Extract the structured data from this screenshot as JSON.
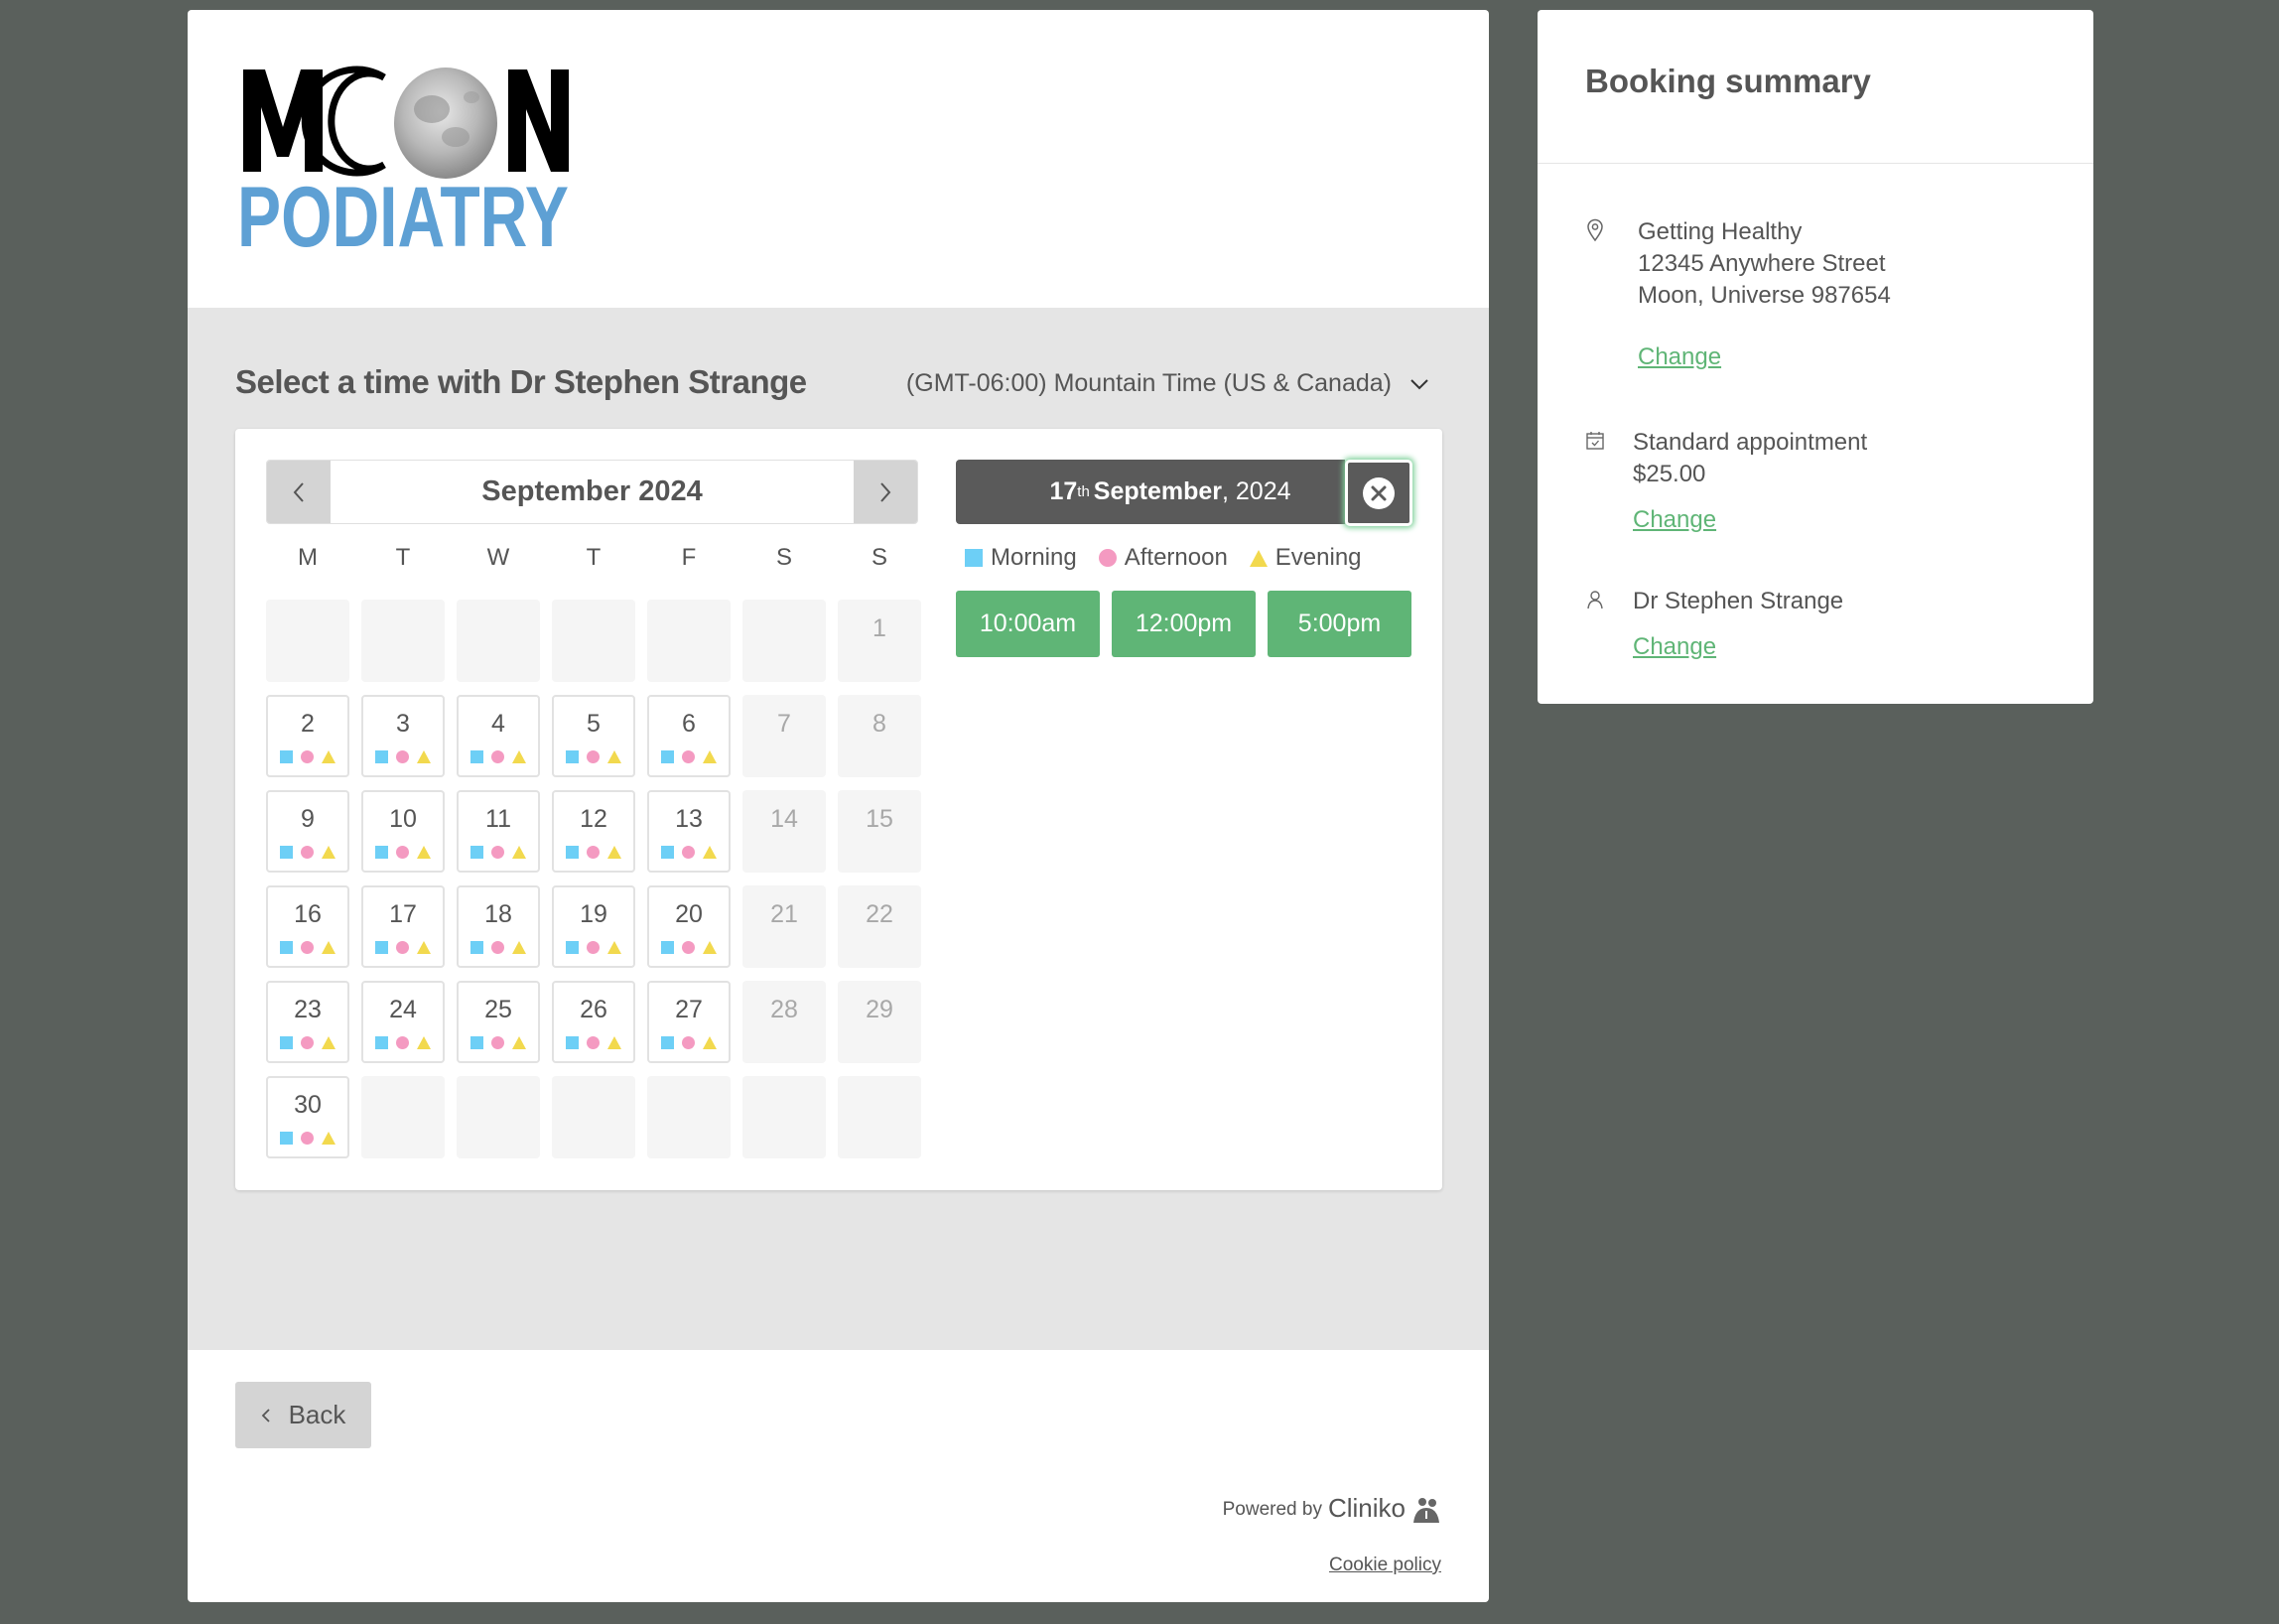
{
  "brand": {
    "logo_top": "MOON",
    "logo_bottom": "PODIATRY",
    "logo_top_color": "#000000",
    "logo_bottom_color": "#5ea0d4"
  },
  "booking": {
    "title": "Select a time with Dr Stephen Strange",
    "timezone": "(GMT-06:00) Mountain Time (US & Canada)"
  },
  "calendar": {
    "month_label": "September 2024",
    "prev_icon": "chevron-left-icon",
    "next_icon": "chevron-right-icon",
    "weekdays": [
      "M",
      "T",
      "W",
      "T",
      "F",
      "S",
      "S"
    ],
    "leading_empty": 6,
    "days_in_month": 30,
    "selected_day": 17,
    "weekday_available": true,
    "weekend_available": false,
    "trailing_empty": 6
  },
  "selected_date": {
    "day": "17",
    "suffix": "th",
    "month": "September",
    "year": ", 2024",
    "close_icon": "close-circle-icon"
  },
  "legend": [
    {
      "label": "Morning",
      "shape": "square",
      "color": "#6dcff6"
    },
    {
      "label": "Afternoon",
      "shape": "circle",
      "color": "#f49ac1"
    },
    {
      "label": "Evening",
      "shape": "triangle",
      "color": "#f2d94e"
    }
  ],
  "time_slots": [
    "10:00am",
    "12:00pm",
    "5:00pm"
  ],
  "footer": {
    "back_label": "Back",
    "powered_by": "Powered by",
    "powered_brand": "Cliniko",
    "cookie_policy": "Cookie policy"
  },
  "summary": {
    "title": "Booking summary",
    "location": {
      "icon": "map-pin-icon",
      "name": "Getting Healthy",
      "address1": "12345 Anywhere Street",
      "address2": "Moon, Universe 987654",
      "change_label": "Change"
    },
    "appointment": {
      "icon": "calendar-check-icon",
      "type": "Standard appointment",
      "price": "$25.00",
      "change_label": "Change"
    },
    "practitioner": {
      "icon": "user-icon",
      "name": "Dr Stephen Strange",
      "change_label": "Change"
    }
  },
  "colors": {
    "accent_green": "#5fb576",
    "header_dark": "#5a5a5a",
    "page_bg": "#5a605c"
  }
}
